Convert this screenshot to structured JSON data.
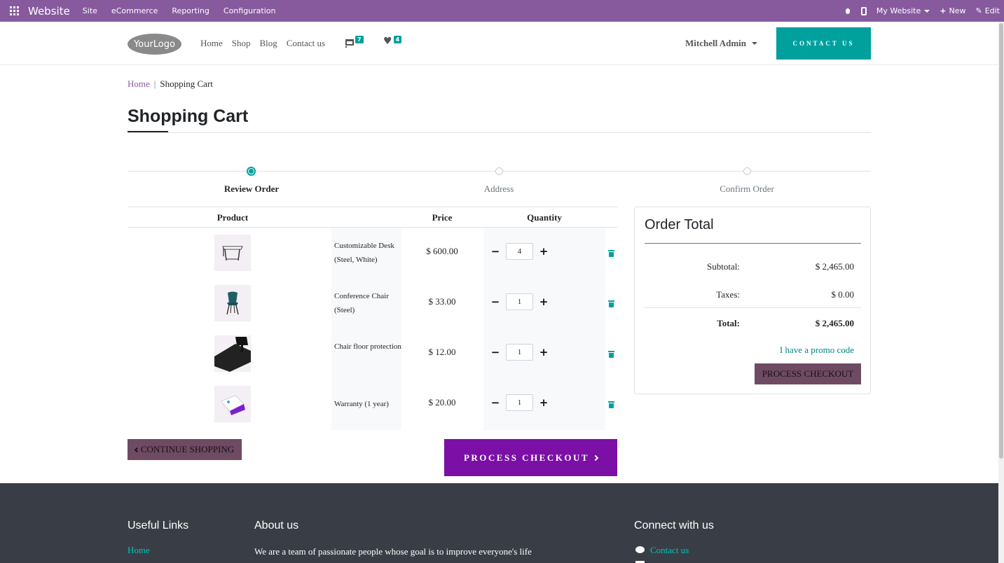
{
  "admin_bar": {
    "brand": "Website",
    "menu": [
      "Site",
      "eCommerce",
      "Reporting",
      "Configuration"
    ],
    "website_selector": "My Website",
    "new_label": "New",
    "edit_label": "Edit"
  },
  "header": {
    "logo_text": "YourLogo",
    "nav": [
      "Home",
      "Shop",
      "Blog",
      "Contact us"
    ],
    "cart_count": "7",
    "wishlist_count": "4",
    "user_name": "Mitchell Admin",
    "contact_button": "CONTACT US"
  },
  "breadcrumb": {
    "home": "Home",
    "current": "Shopping Cart"
  },
  "page_title": "Shopping Cart",
  "wizard": {
    "steps": [
      {
        "label": "Review Order",
        "active": true
      },
      {
        "label": "Address",
        "active": false
      },
      {
        "label": "Confirm Order",
        "active": false
      }
    ]
  },
  "cart": {
    "columns": {
      "product": "Product",
      "price": "Price",
      "quantity": "Quantity"
    },
    "items": [
      {
        "name": "Customizable Desk (Steel, White)",
        "price": "$ 600.00",
        "quantity": "4",
        "image": "desk-thumbnail"
      },
      {
        "name": "Conference Chair (Steel)",
        "price": "$ 33.00",
        "quantity": "1",
        "image": "chair-thumbnail"
      },
      {
        "name": "Chair floor protection",
        "price": "$ 12.00",
        "quantity": "1",
        "image": "floor-mat-thumbnail"
      },
      {
        "name": "Warranty (1 year)",
        "price": "$ 20.00",
        "quantity": "1",
        "image": "warranty-box-thumbnail"
      }
    ],
    "continue_label": "CONTINUE SHOPPING",
    "checkout_label": "PROCESS CHECKOUT"
  },
  "order_total": {
    "title": "Order Total",
    "subtotal_label": "Subtotal:",
    "subtotal_value": "$ 2,465.00",
    "taxes_label": "Taxes:",
    "taxes_value": "$ 0.00",
    "total_label": "Total:",
    "total_value": "$ 2,465.00",
    "promo_label": "I have a promo code",
    "checkout_label": "PROCESS CHECKOUT"
  },
  "footer": {
    "useful_links_title": "Useful Links",
    "useful_links": [
      "Home"
    ],
    "about_title": "About us",
    "about_text": "We are a team of passionate people whose goal is to improve everyone's life",
    "connect_title": "Connect with us",
    "connect_links": [
      "Contact us"
    ]
  },
  "colors": {
    "admin_bar": "#875a9e",
    "primary": "#00a09d",
    "checkout_purple": "#7b0fa6",
    "secondary_button": "#6e4b62",
    "footer_bg": "#393e46"
  }
}
